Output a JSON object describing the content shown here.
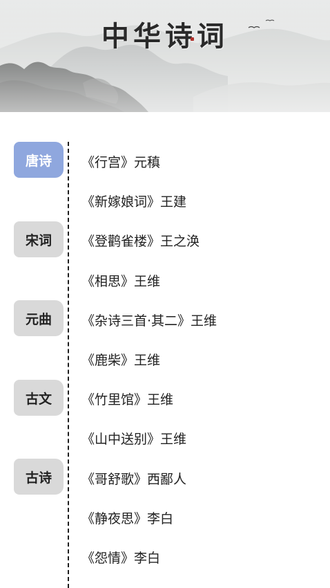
{
  "banner": {
    "title": "中华诗词"
  },
  "categories": [
    {
      "label": "唐诗",
      "active": true
    },
    {
      "label": "宋词",
      "active": false
    },
    {
      "label": "元曲",
      "active": false
    },
    {
      "label": "古文",
      "active": false
    },
    {
      "label": "古诗",
      "active": false
    }
  ],
  "poems": [
    "《行宫》元稹",
    "《新嫁娘词》王建",
    "《登鹳雀楼》王之涣",
    "《相思》王维",
    "《杂诗三首·其二》王维",
    "《鹿柴》王维",
    "《竹里馆》王维",
    "《山中送别》王维",
    "《哥舒歌》西鄙人",
    "《静夜思》李白",
    "《怨情》李白"
  ],
  "colors": {
    "active_category_bg": "#8fa7de",
    "inactive_category_bg": "#d9d9d9",
    "divider": "#1e1e1e"
  }
}
